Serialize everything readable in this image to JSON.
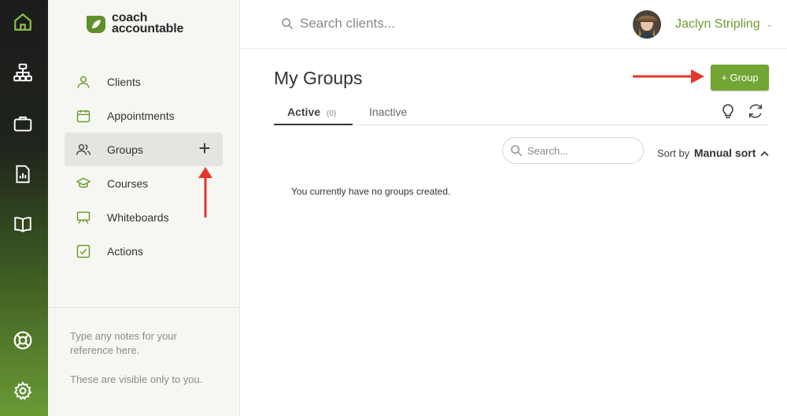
{
  "rail": {
    "icons": [
      "home-icon",
      "org-chart-icon",
      "briefcase-icon",
      "reports-icon",
      "book-icon",
      "help-lifebuoy-icon",
      "settings-gear-icon"
    ]
  },
  "logo": {
    "line1": "coach",
    "line2": "accountable"
  },
  "sidebar": {
    "items": [
      {
        "label": "Clients",
        "icon": "person-icon"
      },
      {
        "label": "Appointments",
        "icon": "calendar-icon"
      },
      {
        "label": "Groups",
        "icon": "people-icon",
        "active": true
      },
      {
        "label": "Courses",
        "icon": "graduation-cap-icon"
      },
      {
        "label": "Whiteboards",
        "icon": "whiteboard-icon"
      },
      {
        "label": "Actions",
        "icon": "checkbox-icon"
      }
    ],
    "add_symbol": "+",
    "notes": {
      "line1": "Type any notes for your reference here.",
      "line2": "These are visible only to you."
    }
  },
  "header": {
    "search_placeholder": "Search clients...",
    "user_name": "Jaclyn Stripling",
    "user_caret": "⌄"
  },
  "main": {
    "title": "My Groups",
    "add_button": "+ Group",
    "tabs": [
      {
        "label": "Active",
        "count": "(0)"
      },
      {
        "label": "Inactive"
      }
    ],
    "search_placeholder": "Search...",
    "sort_label": "Sort by",
    "sort_value": "Manual sort",
    "empty_message": "You currently have no groups created."
  },
  "colors": {
    "accent": "#72a534",
    "accent_text": "#6f9c33",
    "annotation_arrow": "#e0392b"
  }
}
